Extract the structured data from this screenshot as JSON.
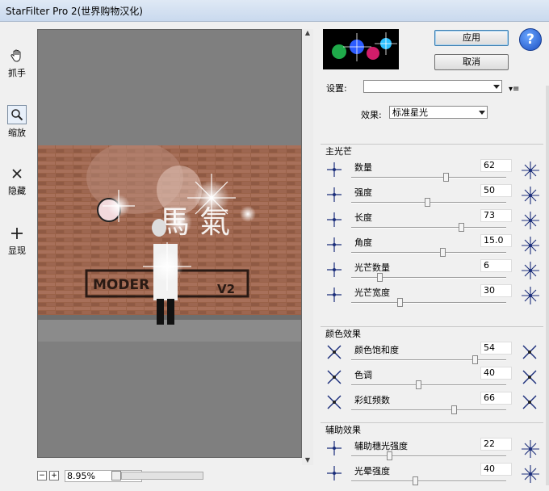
{
  "window": {
    "title": "StarFilter Pro 2(世界购物汉化)"
  },
  "toolbar": {
    "tools": [
      {
        "label": "抓手",
        "icon": "hand-icon"
      },
      {
        "label": "缩放",
        "icon": "magnifier-icon"
      },
      {
        "label": "隐藏",
        "icon": "x-icon"
      },
      {
        "label": "显现",
        "icon": "plus-icon"
      }
    ]
  },
  "preview": {
    "photo_text": "MODER",
    "photo_text2": "V2"
  },
  "bottom": {
    "zoom": "8.95%",
    "minus": "−",
    "plus": "+"
  },
  "buttons": {
    "ok": "应用",
    "cancel": "取消",
    "help": "?"
  },
  "settings": {
    "label": "设置:",
    "value": ""
  },
  "effect": {
    "label": "效果:",
    "value": "标准星光"
  },
  "groups": [
    {
      "title": "主光芒",
      "rows": [
        {
          "name": "数量",
          "value": "62",
          "pos": 0.6
        },
        {
          "name": "强度",
          "value": "50",
          "pos": 0.48
        },
        {
          "name": "长度",
          "value": "73",
          "pos": 0.7
        },
        {
          "name": "角度",
          "value": "15.0",
          "pos": 0.58
        },
        {
          "name": "光芒数量",
          "value": "6",
          "pos": 0.17
        },
        {
          "name": "光芒宽度",
          "value": "30",
          "pos": 0.3
        }
      ]
    },
    {
      "title": "颜色效果",
      "rows": [
        {
          "name": "颜色饱和度",
          "value": "54",
          "pos": 0.79
        },
        {
          "name": "色调",
          "value": "40",
          "pos": 0.42
        },
        {
          "name": "彩虹频数",
          "value": "66",
          "pos": 0.65
        }
      ]
    },
    {
      "title": "辅助效果",
      "rows": [
        {
          "name": "辅助穗光强度",
          "value": "22",
          "pos": 0.23
        },
        {
          "name": "光晕强度",
          "value": "40",
          "pos": 0.4
        }
      ]
    }
  ]
}
